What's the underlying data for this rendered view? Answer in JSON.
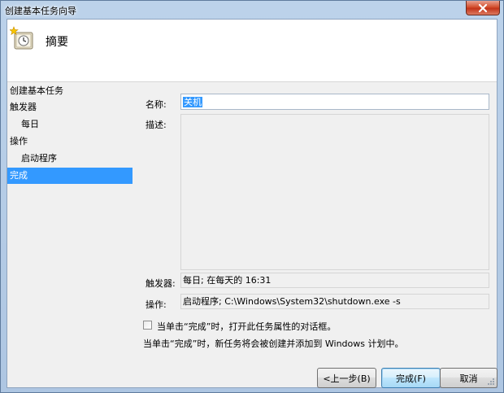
{
  "window": {
    "title": "创建基本任务向导",
    "close_label": "✕"
  },
  "header": {
    "title": "摘要",
    "icon": "task-scheduler-clock-icon"
  },
  "nav": {
    "items": [
      {
        "label": "创建基本任务",
        "sub": false,
        "selected": false
      },
      {
        "label": "触发器",
        "sub": false,
        "selected": false
      },
      {
        "label": "每日",
        "sub": true,
        "selected": false
      },
      {
        "label": "操作",
        "sub": false,
        "selected": false
      },
      {
        "label": "启动程序",
        "sub": true,
        "selected": false
      },
      {
        "label": "完成",
        "sub": false,
        "selected": true
      }
    ]
  },
  "form": {
    "name_label": "名称:",
    "name_value": "关机",
    "desc_label": "描述:",
    "desc_value": "",
    "trigger_label": "触发器:",
    "trigger_value": "每日; 在每天的 16:31",
    "action_label": "操作:",
    "action_value": "启动程序; C:\\Windows\\System32\\shutdown.exe -s",
    "checkbox_label": "当单击“完成”时，打开此任务属性的对话框。",
    "checkbox_checked": false,
    "info_text": "当单击“完成”时，新任务将会被创建并添加到 Windows 计划中。"
  },
  "buttons": {
    "back": "<上一步(B)",
    "finish": "完成(F)",
    "cancel": "取消"
  },
  "colors": {
    "selection": "#3399ff",
    "close_button": "#c7432a"
  }
}
